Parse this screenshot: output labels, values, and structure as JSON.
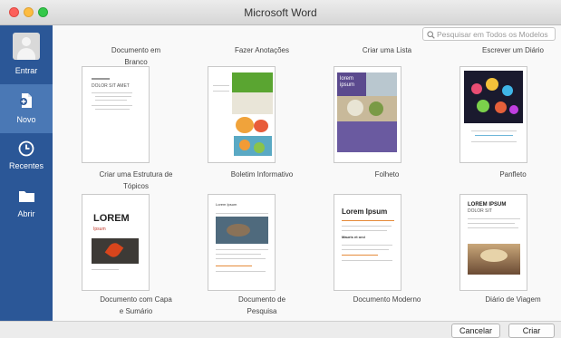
{
  "window": {
    "title": "Microsoft Word"
  },
  "sidebar": {
    "items": [
      {
        "label": "Entrar",
        "icon": "user-icon"
      },
      {
        "label": "Novo",
        "icon": "new-document-icon",
        "active": true
      },
      {
        "label": "Recentes",
        "icon": "clock-icon"
      },
      {
        "label": "Abrir",
        "icon": "folder-icon"
      }
    ],
    "colors": {
      "background": "#2b5797",
      "active": "#4a78b5"
    }
  },
  "search": {
    "placeholder": "Pesquisar em Todos os Modelos"
  },
  "templates": {
    "row1_labels": [
      [
        "Documento em",
        "Branco"
      ],
      [
        "Fazer Anotações",
        ""
      ],
      [
        "Criar uma Lista",
        ""
      ],
      [
        "Escrever um Diário",
        ""
      ]
    ],
    "row2_labels": [
      [
        "Criar uma Estrutura de",
        "Tópicos"
      ],
      [
        "Boletim Informativo",
        ""
      ],
      [
        "Folheto",
        ""
      ],
      [
        "Panfleto",
        ""
      ]
    ],
    "row3_labels": [
      [
        "Documento com Capa",
        "e Sumário"
      ],
      [
        "Documento de",
        "Pesquisa"
      ],
      [
        "Documento Moderno",
        ""
      ],
      [
        "Diário de Viagem",
        ""
      ]
    ],
    "thumb_text": {
      "outline_title": "DOLOR SIT AMET",
      "list_title": "lorem ipsum",
      "cover_title": "LOREM",
      "cover_subtitle": "Ipsum",
      "research_title": "Lorem Ipsum",
      "modern_title": "Lorem Ipsum",
      "modern_section": "Mauris et orci",
      "travel_title": "LOREM IPSUM",
      "travel_sub": "DOLOR SIT"
    }
  },
  "footer": {
    "cancel_label": "Cancelar",
    "create_label": "Criar"
  }
}
